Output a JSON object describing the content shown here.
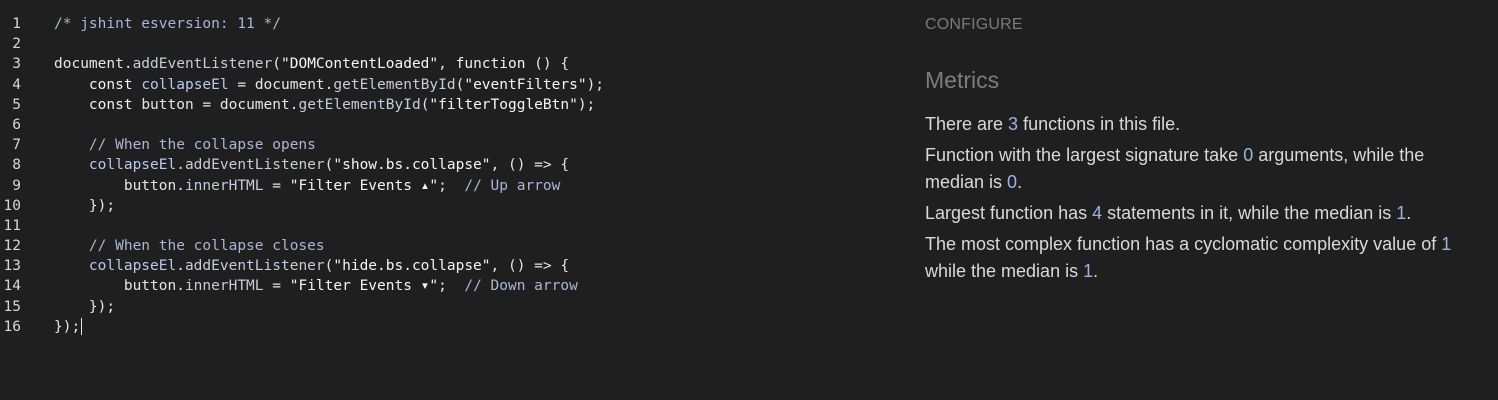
{
  "editor": {
    "lines": [
      {
        "n": "1",
        "tokens": [
          {
            "t": "/* jshint esversion: 11 */",
            "c": "comment"
          }
        ]
      },
      {
        "n": "2",
        "tokens": []
      },
      {
        "n": "3",
        "tokens": [
          {
            "t": "document.",
            "c": "plain"
          },
          {
            "t": "addEventListener",
            "c": "fn"
          },
          {
            "t": "(",
            "c": "plain"
          },
          {
            "t": "\"DOMContentLoaded\"",
            "c": "str"
          },
          {
            "t": ", ",
            "c": "plain"
          },
          {
            "t": "function",
            "c": "kw"
          },
          {
            "t": " () {",
            "c": "plain"
          }
        ]
      },
      {
        "n": "4",
        "tokens": [
          {
            "t": "    const ",
            "c": "kw"
          },
          {
            "t": "collapseEl",
            "c": "id"
          },
          {
            "t": " = document.",
            "c": "plain"
          },
          {
            "t": "getElementById",
            "c": "fn"
          },
          {
            "t": "(",
            "c": "plain"
          },
          {
            "t": "\"eventFilters\"",
            "c": "str"
          },
          {
            "t": ");",
            "c": "plain"
          }
        ]
      },
      {
        "n": "5",
        "tokens": [
          {
            "t": "    const ",
            "c": "kw"
          },
          {
            "t": "button",
            "c": "plain"
          },
          {
            "t": " = document.",
            "c": "plain"
          },
          {
            "t": "getElementById",
            "c": "fn"
          },
          {
            "t": "(",
            "c": "plain"
          },
          {
            "t": "\"filterToggleBtn\"",
            "c": "str"
          },
          {
            "t": ");",
            "c": "plain"
          }
        ]
      },
      {
        "n": "6",
        "tokens": []
      },
      {
        "n": "7",
        "tokens": [
          {
            "t": "    // When the collapse opens",
            "c": "comment"
          }
        ]
      },
      {
        "n": "8",
        "tokens": [
          {
            "t": "    collapseEl",
            "c": "id"
          },
          {
            "t": ".",
            "c": "plain"
          },
          {
            "t": "addEventListener",
            "c": "fn"
          },
          {
            "t": "(",
            "c": "plain"
          },
          {
            "t": "\"show.bs.collapse\"",
            "c": "str"
          },
          {
            "t": ", () => {",
            "c": "plain"
          }
        ]
      },
      {
        "n": "9",
        "tokens": [
          {
            "t": "        button.",
            "c": "plain"
          },
          {
            "t": "innerHTML",
            "c": "fn"
          },
          {
            "t": " = ",
            "c": "plain"
          },
          {
            "t": "\"Filter Events ▴\"",
            "c": "str"
          },
          {
            "t": ";  ",
            "c": "plain"
          },
          {
            "t": "// Up arrow",
            "c": "comment"
          }
        ]
      },
      {
        "n": "10",
        "tokens": [
          {
            "t": "    });",
            "c": "plain"
          }
        ]
      },
      {
        "n": "11",
        "tokens": []
      },
      {
        "n": "12",
        "tokens": [
          {
            "t": "    // When the collapse closes",
            "c": "comment"
          }
        ]
      },
      {
        "n": "13",
        "tokens": [
          {
            "t": "    collapseEl",
            "c": "id"
          },
          {
            "t": ".",
            "c": "plain"
          },
          {
            "t": "addEventListener",
            "c": "fn"
          },
          {
            "t": "(",
            "c": "plain"
          },
          {
            "t": "\"hide.bs.collapse\"",
            "c": "str"
          },
          {
            "t": ", () => {",
            "c": "plain"
          }
        ]
      },
      {
        "n": "14",
        "tokens": [
          {
            "t": "        button.",
            "c": "plain"
          },
          {
            "t": "innerHTML",
            "c": "fn"
          },
          {
            "t": " = ",
            "c": "plain"
          },
          {
            "t": "\"Filter Events ▾\"",
            "c": "str"
          },
          {
            "t": ";  ",
            "c": "plain"
          },
          {
            "t": "// Down arrow",
            "c": "comment"
          }
        ]
      },
      {
        "n": "15",
        "tokens": [
          {
            "t": "    });",
            "c": "plain"
          }
        ]
      },
      {
        "n": "16",
        "tokens": [
          {
            "t": "});",
            "c": "plain"
          }
        ],
        "caret": true
      }
    ]
  },
  "sidebar": {
    "configure_label": "CONFIGURE",
    "metrics_title": "Metrics",
    "metrics": [
      [
        {
          "t": "There are "
        },
        {
          "t": "3",
          "num": true
        },
        {
          "t": " functions in this file."
        }
      ],
      [
        {
          "t": "Function with the largest signature take "
        },
        {
          "t": "0",
          "num": true
        },
        {
          "t": " arguments, while the median is "
        },
        {
          "t": "0",
          "num": true
        },
        {
          "t": "."
        }
      ],
      [
        {
          "t": "Largest function has "
        },
        {
          "t": "4",
          "num": true
        },
        {
          "t": " statements in it, while the median is "
        },
        {
          "t": "1",
          "num": true
        },
        {
          "t": "."
        }
      ],
      [
        {
          "t": "The most complex function has a cyclomatic complexity value of "
        },
        {
          "t": "1",
          "num": true
        },
        {
          "t": " while the median is "
        },
        {
          "t": "1",
          "num": true
        },
        {
          "t": "."
        }
      ]
    ]
  }
}
